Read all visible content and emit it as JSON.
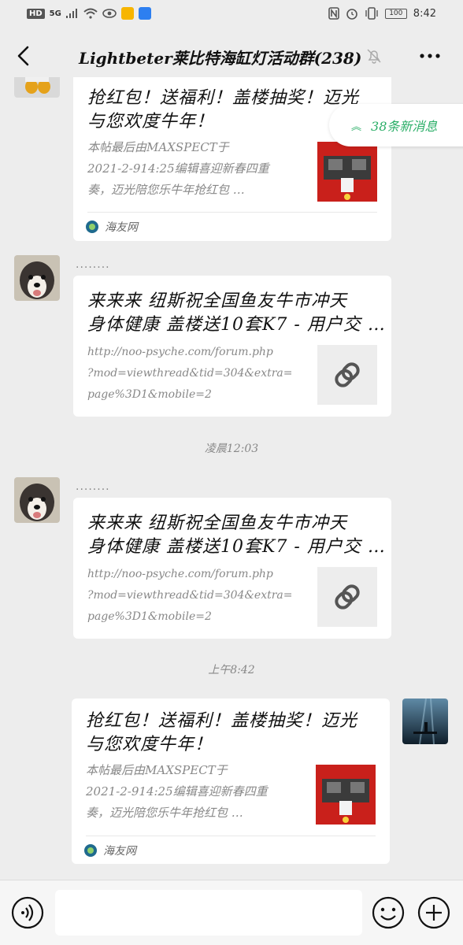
{
  "status_bar": {
    "hd": "HD",
    "network": "5G",
    "battery": "100",
    "time": "8:42"
  },
  "navbar": {
    "title": "Lightbeter莱比特海缸灯活动群(238)"
  },
  "new_messages": {
    "label": "38条新消息"
  },
  "messages": [
    {
      "title_line1": "抢红包！送福利！盖楼抽奖！迈光",
      "title_line2": "与您欢度牛年！",
      "desc_line1": "本帖最后由MAXSPECT于",
      "desc_line2": "2021-2-914:25编辑喜迎新春四重",
      "desc_line3": "奏，迈光陪您乐牛年抢红包 …",
      "source": "海友网"
    },
    {
      "sender": "........",
      "title_line1": "来来来 纽斯祝全国鱼友牛市冲天",
      "title_line2": "身体健康 盖楼送10套K7 - 用户交 …",
      "desc_line1": "http://noo-psyche.com/forum.php",
      "desc_line2": "?mod=viewthread&tid=304&extra=",
      "desc_line3": "page%3D1&mobile=2"
    },
    {
      "sender": "........",
      "title_line1": "来来来 纽斯祝全国鱼友牛市冲天",
      "title_line2": "身体健康 盖楼送10套K7 - 用户交 …",
      "desc_line1": "http://noo-psyche.com/forum.php",
      "desc_line2": "?mod=viewthread&tid=304&extra=",
      "desc_line3": "page%3D1&mobile=2"
    },
    {
      "title_line1": "抢红包！送福利！盖楼抽奖！迈光",
      "title_line2": "与您欢度牛年！",
      "desc_line1": "本帖最后由MAXSPECT于",
      "desc_line2": "2021-2-914:25编辑喜迎新春四重",
      "desc_line3": "奏，迈光陪您乐牛年抢红包 …",
      "source": "海友网"
    }
  ],
  "timestamps": {
    "first": "凌晨12:03",
    "second": "上午8:42"
  },
  "colors": {
    "accent_green": "#2aae67",
    "background": "#ededed"
  }
}
